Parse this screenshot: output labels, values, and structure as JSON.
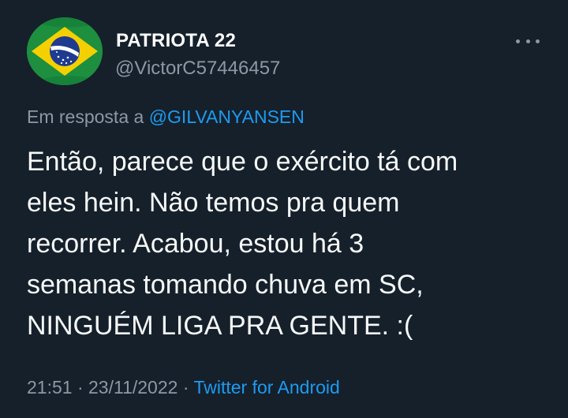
{
  "user": {
    "display_name": "PATRIOTA 22",
    "handle": "@VictorC57446457"
  },
  "reply": {
    "prefix": "Em resposta a",
    "target": "@GILVANYANSEN"
  },
  "tweet": {
    "lines": [
      "Então, parece que o exército tá com",
      "eles hein. Não temos pra quem",
      "recorrer. Acabou, estou há 3",
      "semanas tomando chuva em SC,",
      "NINGUÉM LIGA PRA GENTE. :("
    ]
  },
  "meta": {
    "time": "21:51",
    "separator": "·",
    "date": "23/11/2022",
    "source": "Twitter for Android"
  },
  "icons": {
    "avatar": "brazil-flag-avatar",
    "more": "more-options-icon"
  },
  "colors": {
    "background": "#15202b",
    "text": "#f7f9f9",
    "secondary": "#8b98a5",
    "accent": "#1d9bf0"
  }
}
